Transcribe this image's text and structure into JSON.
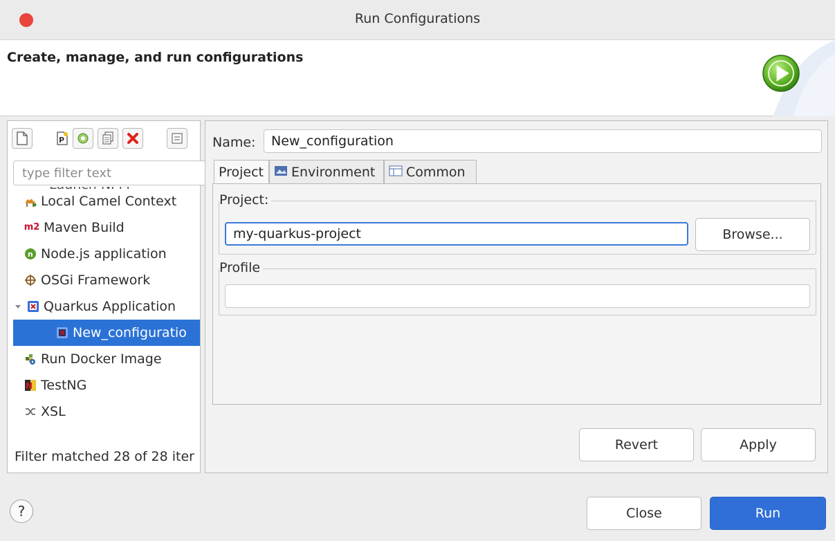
{
  "window": {
    "title": "Run Configurations"
  },
  "header": {
    "title": "Create, manage, and run configurations"
  },
  "left": {
    "filter_placeholder": "type filter text",
    "cut_item_label": "Launch NPM",
    "items": [
      {
        "label": "Local Camel Context",
        "icon": "camel-icon"
      },
      {
        "label": "Maven Build",
        "icon": "maven-m2-icon"
      },
      {
        "label": "Node.js application",
        "icon": "nodejs-icon"
      },
      {
        "label": "OSGi Framework",
        "icon": "osgi-icon"
      },
      {
        "label": "Quarkus Application",
        "icon": "quarkus-icon"
      },
      {
        "label": "New_configuratio",
        "icon": "quarkus-icon"
      },
      {
        "label": "Run Docker Image",
        "icon": "docker-icon"
      },
      {
        "label": "TestNG",
        "icon": "testng-icon"
      },
      {
        "label": "XSL",
        "icon": "xsl-icon"
      }
    ],
    "status": "Filter matched 28 of 28 iter"
  },
  "right": {
    "name_label": "Name:",
    "name_value": "New_configuration",
    "tabs": [
      {
        "label": "Project"
      },
      {
        "label": "Environment"
      },
      {
        "label": "Common"
      }
    ],
    "project_group": "Project:",
    "project_value": "my-quarkus-project",
    "browse_label": "Browse...",
    "profile_group": "Profile",
    "profile_value": "",
    "revert_label": "Revert",
    "apply_label": "Apply"
  },
  "footer": {
    "help_label": "?",
    "close_label": "Close",
    "run_label": "Run"
  },
  "colors": {
    "accent": "#2f6fd7",
    "selection": "#2a72d6",
    "close_dot": "#e8453c"
  }
}
